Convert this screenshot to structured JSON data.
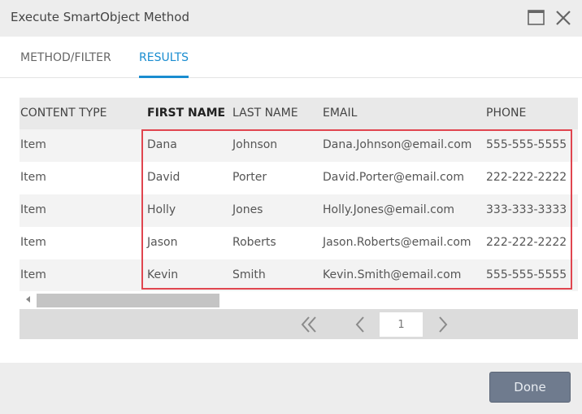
{
  "window": {
    "title": "Execute SmartObject Method"
  },
  "tabs": [
    {
      "label": "METHOD/FILTER",
      "active": false
    },
    {
      "label": "RESULTS",
      "active": true
    }
  ],
  "grid": {
    "columns": [
      "CONTENT TYPE",
      "FIRST NAME",
      "LAST NAME",
      "EMAIL",
      "PHONE"
    ],
    "rows": [
      [
        "Item",
        "Dana",
        "Johnson",
        "Dana.Johnson@email.com",
        "555-555-5555"
      ],
      [
        "Item",
        "David",
        "Porter",
        "David.Porter@email.com",
        "222-222-2222"
      ],
      [
        "Item",
        "Holly",
        "Jones",
        "Holly.Jones@email.com",
        "333-333-3333"
      ],
      [
        "Item",
        "Jason",
        "Roberts",
        "Jason.Roberts@email.com",
        "222-222-2222"
      ],
      [
        "Item",
        "Kevin",
        "Smith",
        "Kevin.Smith@email.com",
        "555-555-5555"
      ]
    ]
  },
  "pager": {
    "page": "1"
  },
  "footer": {
    "done_label": "Done"
  },
  "colors": {
    "accent": "#1a8dd0",
    "highlight": "#e0454f",
    "done_button": "#6f7b8e"
  },
  "icons": {
    "maximize": "maximize-icon",
    "close": "close-icon",
    "first_page": "double-chevron-left-icon",
    "prev_page": "chevron-left-icon",
    "next_page": "chevron-right-icon",
    "scroll_left": "scroll-left-arrow-icon"
  }
}
